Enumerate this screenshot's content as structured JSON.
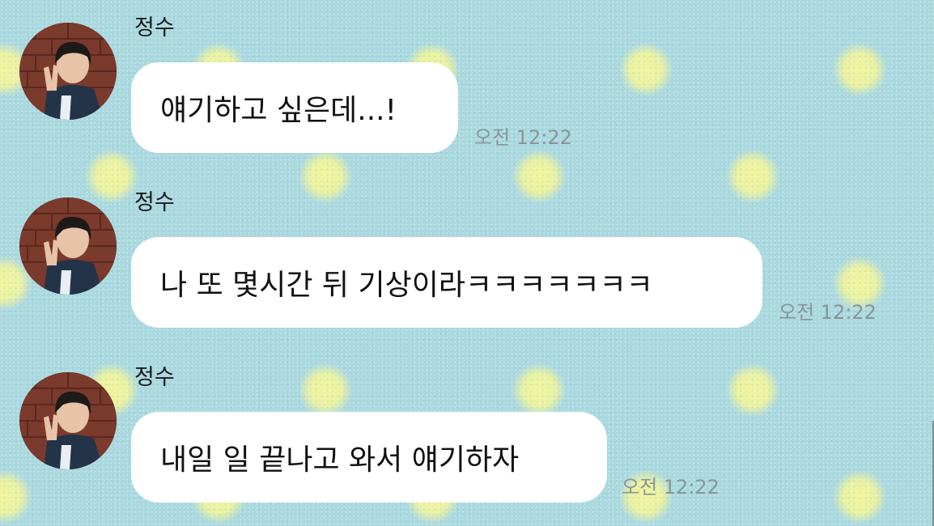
{
  "chat": {
    "messages": [
      {
        "sender": "정수",
        "text": "얘기하고 싶은데...!",
        "time": "오전 12:22"
      },
      {
        "sender": "정수",
        "text": "나 또 몇시간 뒤 기상이라ㅋㅋㅋㅋㅋㅋㅋ",
        "time": "오전 12:22"
      },
      {
        "sender": "정수",
        "text": "내일 일 끝나고 와서 얘기하자",
        "time": "오전 12:22"
      }
    ]
  },
  "colors": {
    "background": "#a9d8df",
    "polka_dot": "#f4f596",
    "bubble": "#ffffff",
    "timestamp": "#8a9599"
  },
  "icons": {
    "avatar": "profile-photo"
  }
}
